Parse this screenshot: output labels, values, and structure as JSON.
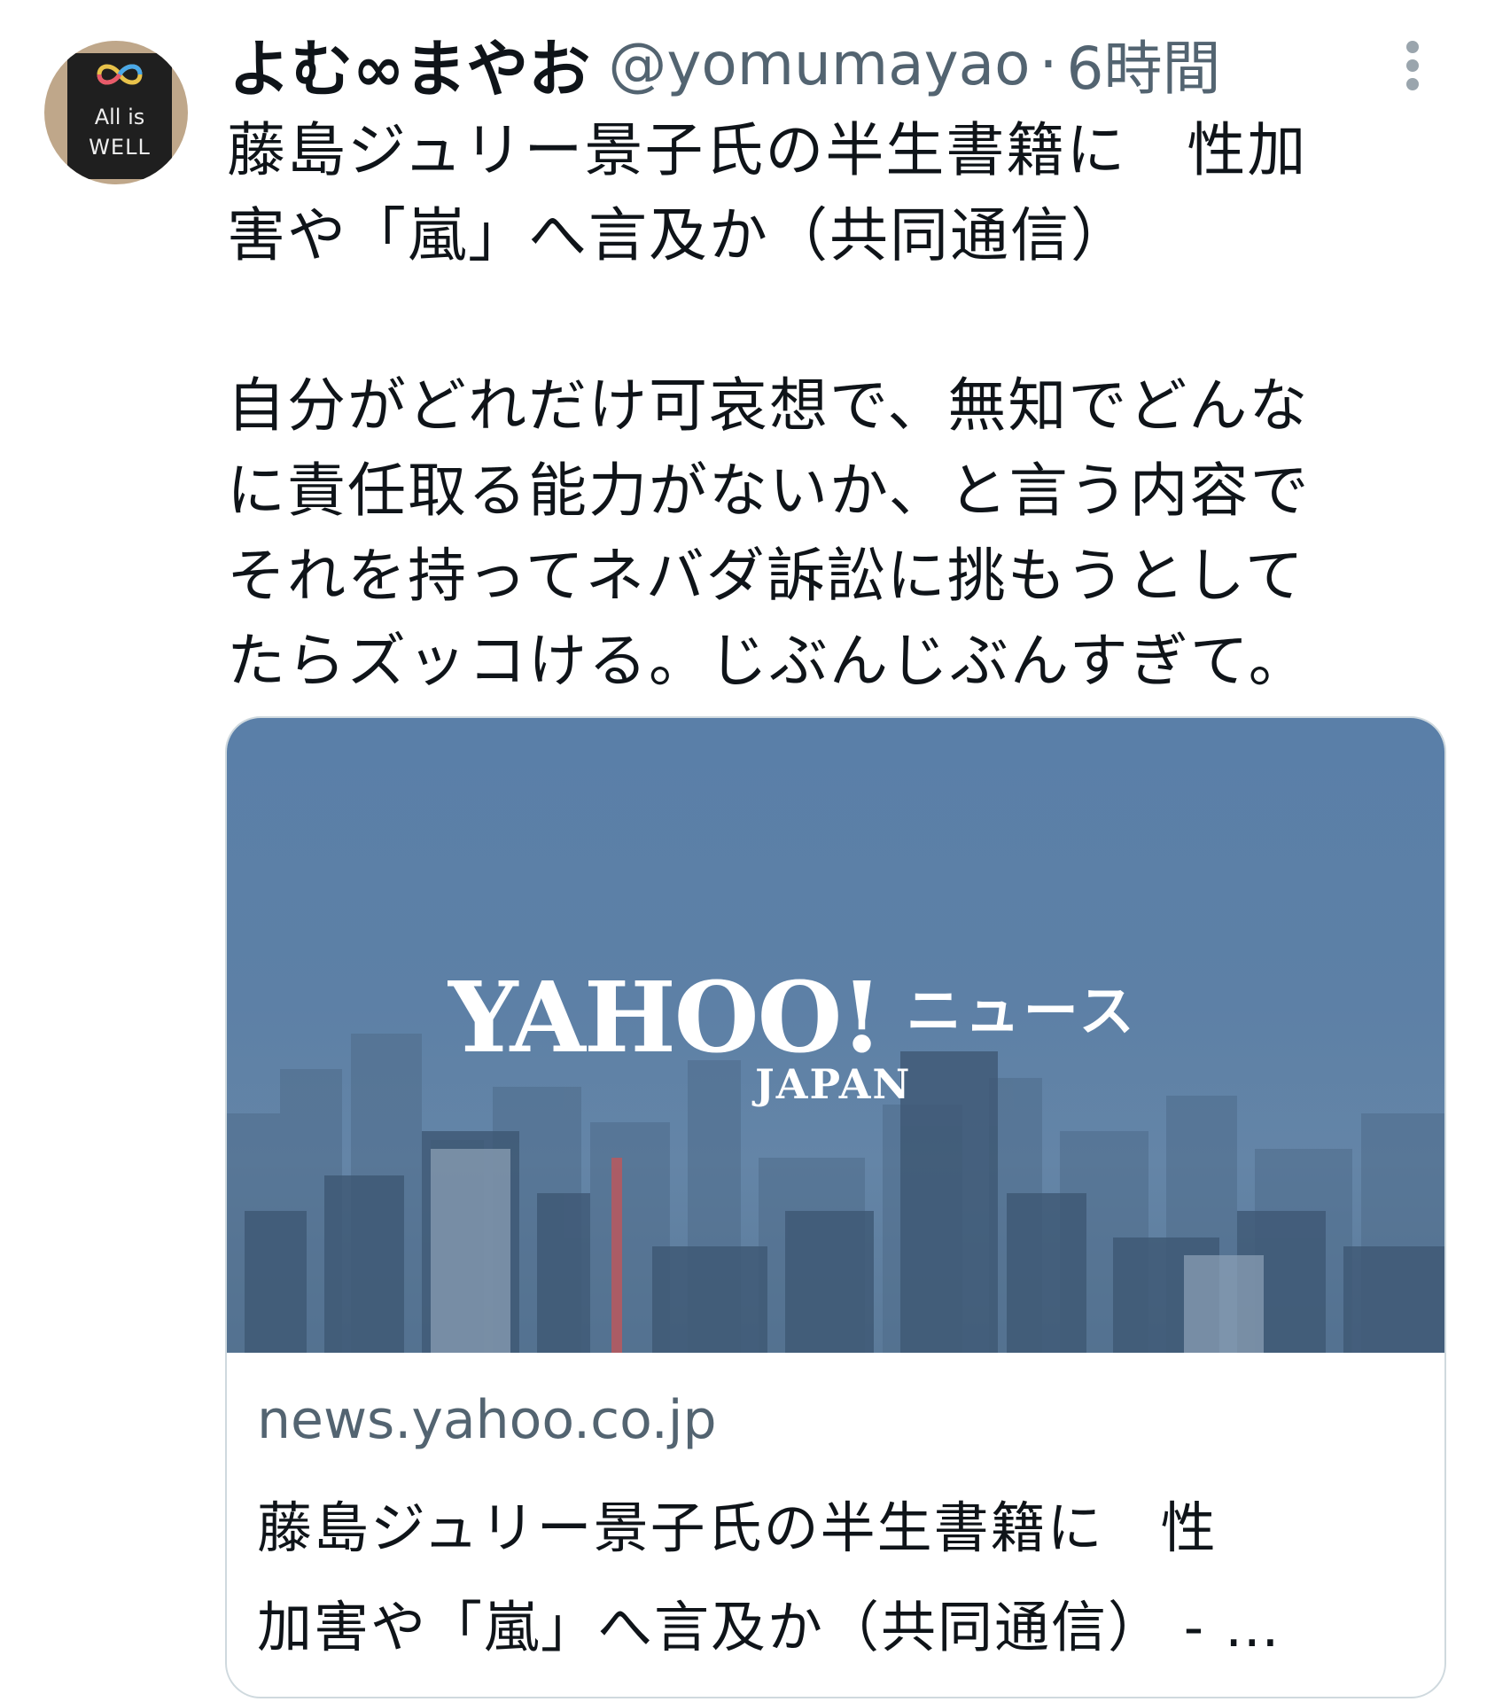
{
  "tweet": {
    "display_name": "よむ∞まやお",
    "handle": "@yomumayao",
    "separator": "·",
    "time": "6時間",
    "avatar_text_line1": "All is",
    "avatar_text_line2": "WELL",
    "more_icon": "more-vertical-icon",
    "text": "藤島ジュリー景子氏の半生書籍に　性加\n害や「嵐」へ言及か（共同通信）\n\n自分がどれだけ可哀想で、無知でどんな\nに責任取る能力がないか、と言う内容で\nそれを持ってネバダ訴訟に挑もうとして\nたらズッコける。じぶんじぶんすぎて。"
  },
  "card": {
    "logo_main": "YAHOO!",
    "logo_sub": "JAPAN",
    "logo_news": "ニュース",
    "domain": "news.yahoo.co.jp",
    "title": "藤島ジュリー景子氏の半生書籍に　性\n加害や「嵐」へ言及か（共同通信） - …"
  },
  "colors": {
    "text_primary": "#0f1419",
    "text_secondary": "#536471",
    "card_border": "#cfd9de",
    "card_image_bg": "#5a7fa8"
  }
}
